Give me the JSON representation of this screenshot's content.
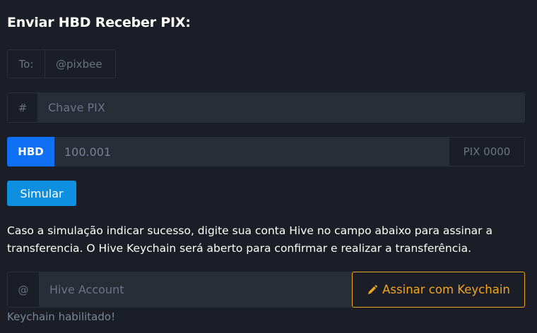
{
  "title": "Enviar HBD Receber PIX:",
  "to": {
    "label": "To:",
    "value": "@pixbee"
  },
  "pix_key": {
    "addon": "#",
    "placeholder": "Chave PIX"
  },
  "amount": {
    "currency": "HBD",
    "value": "100.001",
    "output": "PIX 0000"
  },
  "simulate_button": "Simular",
  "info_text": "Caso a simulação indicar sucesso, digite sua conta Hive no campo abaixo para assinar a transferencia. O Hive Keychain será aberto para confirmar e realizar a transferência.",
  "hive_account": {
    "addon": "@",
    "placeholder": "Hive Account"
  },
  "keychain_button": {
    "icon": "pencil-icon",
    "label": "Assinar com Keychain"
  },
  "status": "Keychain habilitado!",
  "colors": {
    "background": "#1b1e27",
    "input": "#292d37",
    "hbd": "#0f6ff5",
    "simulate": "#0f8fe0",
    "keychain": "#f0a51e"
  }
}
